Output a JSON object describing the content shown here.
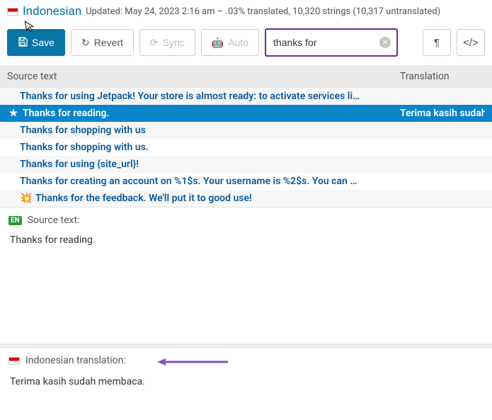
{
  "header": {
    "language": "Indonesian",
    "meta": "Updated: May 24, 2023 2:16 am – .03% translated, 10,320 strings (10,317 untranslated)"
  },
  "toolbar": {
    "save": "Save",
    "revert": "Revert",
    "sync": "Sync",
    "auto": "Auto",
    "search_value": "thanks for",
    "pilcrow": "¶",
    "code": "</>"
  },
  "columns": {
    "source": "Source text",
    "translation": "Translation"
  },
  "rows": [
    {
      "text": "Thanks for using Jetpack! Your store is almost ready: to activate services li…",
      "translation": "",
      "selected": false,
      "icon": ""
    },
    {
      "text": "Thanks for reading.",
      "translation": "Terima kasih sudah m",
      "selected": true,
      "icon": "star"
    },
    {
      "text": "Thanks for shopping with us",
      "translation": "",
      "selected": false,
      "icon": ""
    },
    {
      "text": "Thanks for shopping with us.",
      "translation": "",
      "selected": false,
      "icon": ""
    },
    {
      "text": "Thanks for using {site_url}!",
      "translation": "",
      "selected": false,
      "icon": ""
    },
    {
      "text": "Thanks for creating an account on %1$s. Your username is %2$s. You can …",
      "translation": "",
      "selected": false,
      "icon": ""
    },
    {
      "text": "Thanks for the feedback. We'll put it to good use!",
      "translation": "",
      "selected": false,
      "icon": "burst"
    }
  ],
  "source_panel": {
    "badge": "EN",
    "label": "Source text:",
    "body": "Thanks for reading."
  },
  "trans_panel": {
    "label": "Indonesian translation:",
    "body": "Terima kasih sudah membaca."
  }
}
